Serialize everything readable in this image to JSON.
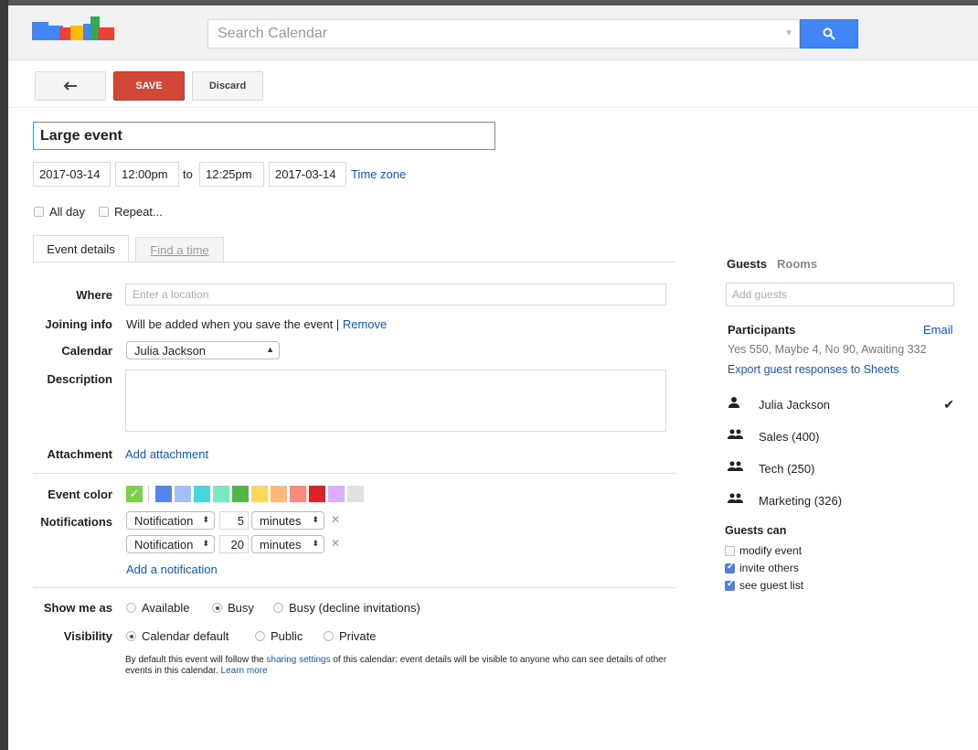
{
  "header": {
    "search_placeholder": "Search Calendar"
  },
  "toolbar": {
    "back_icon": "back-arrow-icon",
    "save_label": "SAVE",
    "discard_label": "Discard"
  },
  "event": {
    "title": "Large event",
    "start_date": "2017-03-14",
    "start_time": "12:00pm",
    "to_label": "to",
    "end_time": "12:25pm",
    "end_date": "2017-03-14",
    "time_zone_link": "Time zone",
    "all_day_label": "All day",
    "all_day_checked": false,
    "repeat_label": "Repeat...",
    "repeat_checked": false
  },
  "tabs": {
    "event_details": "Event details",
    "find_a_time": "Find a time"
  },
  "details": {
    "where_label": "Where",
    "where_placeholder": "Enter a location",
    "joining_label": "Joining info",
    "joining_text": "Will be added when you save the event |",
    "joining_remove": "Remove",
    "calendar_label": "Calendar",
    "calendar_value": "Julia Jackson",
    "description_label": "Description",
    "attachment_label": "Attachment",
    "attachment_link": "Add attachment",
    "event_color_label": "Event color",
    "colors": [
      "#7bd148",
      "#5484ed",
      "#a4bdfc",
      "#46d6db",
      "#7ae7bf",
      "#51b749",
      "#fbd75b",
      "#ffb878",
      "#ff887c",
      "#dc2127",
      "#dbadff",
      "#e1e1e1"
    ],
    "notifications_label": "Notifications",
    "notifications": [
      {
        "type": "Notification",
        "amount": "5",
        "unit": "minutes"
      },
      {
        "type": "Notification",
        "amount": "20",
        "unit": "minutes"
      }
    ],
    "add_notification": "Add a notification",
    "show_me_as_label": "Show me as",
    "show_me_as_options": [
      "Available",
      "Busy",
      "Busy (decline invitations)"
    ],
    "show_me_as_selected": "Busy",
    "visibility_label": "Visibility",
    "visibility_options": [
      "Calendar default",
      "Public",
      "Private"
    ],
    "visibility_selected": "Calendar default",
    "help_text_1": "By default this event will follow the",
    "help_link_1": "sharing settings",
    "help_text_2": "of this calendar: event details will be visible to anyone who can see details of other events in this calendar.",
    "help_link_2": "Learn more"
  },
  "guests": {
    "guests_tab": "Guests",
    "rooms_tab": "Rooms",
    "add_placeholder": "Add guests",
    "participants_label": "Participants",
    "email_link": "Email",
    "summary": "Yes 550, Maybe 4, No 90, Awaiting 332",
    "export_link": "Export guest responses to Sheets",
    "list": [
      {
        "name": "Julia Jackson",
        "icon": "person-icon",
        "checked": true
      },
      {
        "name": "Sales (400)",
        "icon": "group-icon",
        "checked": false
      },
      {
        "name": "Tech (250)",
        "icon": "group-icon",
        "checked": false
      },
      {
        "name": "Marketing (326)",
        "icon": "group-icon",
        "checked": false
      }
    ],
    "guests_can_label": "Guests can",
    "permissions": [
      {
        "label": "modify event",
        "checked": false
      },
      {
        "label": "invite others",
        "checked": true
      },
      {
        "label": "see guest list",
        "checked": true
      }
    ]
  }
}
